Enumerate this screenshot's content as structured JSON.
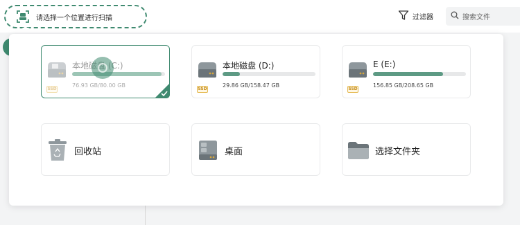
{
  "toolbar": {
    "scan_location_label": "请选择一个位置进行扫描",
    "filter_label": "过滤器",
    "search_placeholder": "搜索文件"
  },
  "drives": [
    {
      "name": "本地磁盘 (C:)",
      "usage": "76.93 GB/80.00 GB",
      "used_fraction": 0.96,
      "badge": "SSD",
      "selected": true
    },
    {
      "name": "本地磁盘 (D:)",
      "usage": "29.86 GB/158.47 GB",
      "used_fraction": 0.19,
      "badge": "SSD",
      "selected": false
    },
    {
      "name": "E (E:)",
      "usage": "156.85 GB/208.65 GB",
      "used_fraction": 0.75,
      "badge": "SSD",
      "selected": false
    }
  ],
  "locations": [
    {
      "name": "回收站",
      "icon": "recycle-bin-icon"
    },
    {
      "name": "桌面",
      "icon": "desktop-icon"
    },
    {
      "name": "选择文件夹",
      "icon": "folder-icon"
    }
  ],
  "colors": {
    "accent": "#3f8a70",
    "bar_fill": "#5d9a84",
    "ssd_badge": "#e4b74a"
  }
}
